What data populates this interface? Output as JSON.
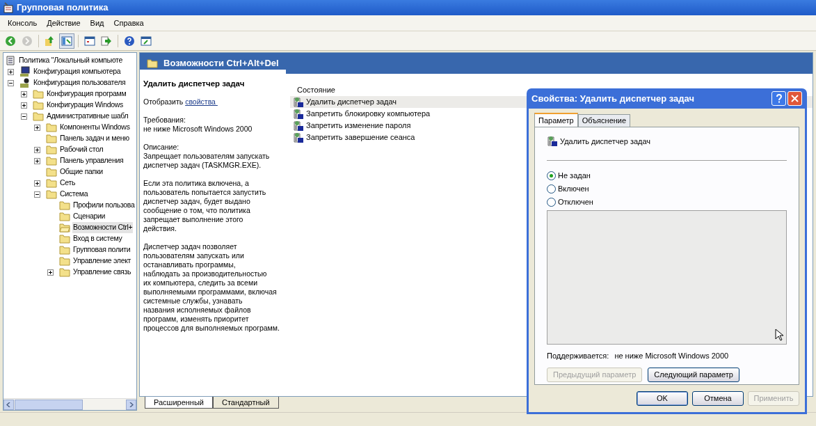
{
  "window": {
    "title": "Групповая политика"
  },
  "menu": [
    "Консоль",
    "Действие",
    "Вид",
    "Справка"
  ],
  "toolbar": [
    {
      "kind": "back",
      "disabled": false
    },
    {
      "kind": "forward",
      "disabled": true
    },
    {
      "kind": "sep"
    },
    {
      "kind": "up",
      "disabled": false
    },
    {
      "kind": "tree",
      "disabled": false,
      "selected": true
    },
    {
      "kind": "sep"
    },
    {
      "kind": "props",
      "disabled": false
    },
    {
      "kind": "export",
      "disabled": false
    },
    {
      "kind": "sep"
    },
    {
      "kind": "help",
      "disabled": false
    },
    {
      "kind": "view",
      "disabled": false
    }
  ],
  "tree": [
    {
      "label": "Политика \"Локальный компьюте",
      "kind": "policy",
      "selected": false,
      "children": [
        {
          "label": "Конфигурация компьютера",
          "kind": "computer",
          "expanded": false,
          "selected": false
        },
        {
          "label": "Конфигурация пользователя",
          "kind": "user",
          "expanded": true,
          "selected": false,
          "children": [
            {
              "label": "Конфигурация программ",
              "kind": "folder",
              "expanded": false,
              "selected": false
            },
            {
              "label": "Конфигурация Windows",
              "kind": "folder",
              "expanded": false,
              "selected": false
            },
            {
              "label": "Административные шабл",
              "kind": "folder",
              "expanded": true,
              "selected": false,
              "children": [
                {
                  "label": "Компоненты Windows",
                  "kind": "folder",
                  "expanded": false,
                  "selected": false
                },
                {
                  "label": "Панель задач и меню",
                  "kind": "folder",
                  "selected": false
                },
                {
                  "label": "Рабочий стол",
                  "kind": "folder",
                  "expanded": false,
                  "selected": false
                },
                {
                  "label": "Панель управления",
                  "kind": "folder",
                  "expanded": false,
                  "selected": false
                },
                {
                  "label": "Общие папки",
                  "kind": "folder",
                  "selected": false
                },
                {
                  "label": "Сеть",
                  "kind": "folder",
                  "expanded": false,
                  "selected": false
                },
                {
                  "label": "Система",
                  "kind": "folder",
                  "expanded": true,
                  "selected": false,
                  "children": [
                    {
                      "label": "Профили пользова",
                      "kind": "folder",
                      "selected": false
                    },
                    {
                      "label": "Сценарии",
                      "kind": "folder",
                      "selected": false
                    },
                    {
                      "label": "Возможности Ctrl+",
                      "kind": "open-folder",
                      "selected": true
                    },
                    {
                      "label": "Вход в систему",
                      "kind": "folder",
                      "selected": false
                    },
                    {
                      "label": "Групповая полити",
                      "kind": "folder",
                      "selected": false
                    },
                    {
                      "label": "Управление элект",
                      "kind": "folder",
                      "selected": false
                    },
                    {
                      "label": "Управление связь",
                      "kind": "folder",
                      "expanded": false,
                      "selected": false
                    }
                  ]
                }
              ]
            }
          ]
        }
      ]
    }
  ],
  "pane_header": "Возможности Ctrl+Alt+Del",
  "description": {
    "title": "Удалить диспетчер задач",
    "show_prefix": "Отобразить",
    "show_link": "свойства ",
    "paragraphs": [
      "Требования:\nне ниже Microsoft Windows 2000",
      "Описание:\nЗапрещает пользователям запускать\nдиспетчер задач (TASKMGR.EXE).",
      "Если эта политика включена, а\nпользователь попытается запустить\nдиспетчер задач, будет выдано\nсообщение о том, что политика\nзапрещает выполнение этого\nдействия.",
      "Диспетчер задач позволяет\nпользователям запускать или\nостанавливать программы,\nнаблюдать за производительностью\nих компьютера, следить за всеми\nвыполняемыми программами, включая\nсистемные службы, узнавать\nназвания исполняемых файлов\nпрограмм, изменять приоритет\nпроцессов для выполняемых программ."
    ]
  },
  "list": {
    "column": "Состояние",
    "rows": [
      {
        "label": "Удалить диспетчер задач",
        "selected": true
      },
      {
        "label": "Запретить блокировку компьютера",
        "selected": false
      },
      {
        "label": "Запретить изменение пароля",
        "selected": false
      },
      {
        "label": "Запретить завершение сеанса",
        "selected": false
      }
    ]
  },
  "view_tabs": [
    {
      "label": "Расширенный",
      "selected": true
    },
    {
      "label": "Стандартный",
      "selected": false
    }
  ],
  "dialog": {
    "title": "Свойства: Удалить диспетчер задач",
    "tabs": [
      {
        "label": "Параметр",
        "selected": true
      },
      {
        "label": "Объяснение",
        "selected": false
      }
    ],
    "setting": "Удалить диспетчер задач",
    "options": [
      {
        "label": "Не задан",
        "selected": true
      },
      {
        "label": "Включен",
        "selected": false
      },
      {
        "label": "Отключен",
        "selected": false
      }
    ],
    "supported_label": "Поддерживается:",
    "supported_value": "не ниже Microsoft Windows 2000",
    "nav_buttons": [
      {
        "label": "Предыдущий параметр",
        "disabled": true
      },
      {
        "label": "Следующий параметр",
        "disabled": false
      }
    ],
    "buttons": [
      {
        "label": "OK",
        "disabled": false,
        "default": true
      },
      {
        "label": "Отмена",
        "disabled": false,
        "default": false
      },
      {
        "label": "Применить",
        "disabled": true,
        "default": false
      }
    ]
  }
}
